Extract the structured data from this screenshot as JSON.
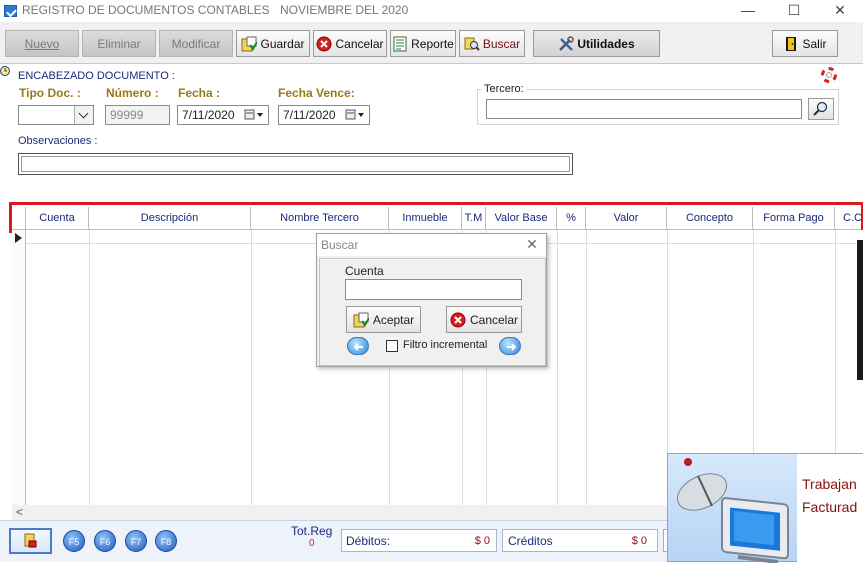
{
  "window": {
    "title": "REGISTRO DE DOCUMENTOS CONTABLES",
    "period": "NOVIEMBRE DEL 2020",
    "minimize": "—",
    "maximize": "☐",
    "close": "✕"
  },
  "toolbar": {
    "nuevo": "Nuevo",
    "eliminar": "Eliminar",
    "modificar": "Modificar",
    "guardar": "Guardar",
    "cancelar": "Cancelar",
    "reporte": "Reporte",
    "buscar": "Buscar",
    "utilidades": "Utilidades",
    "salir": "Salir"
  },
  "header": {
    "section_title": "ENCABEZADO DOCUMENTO :",
    "tipo_doc_label": "Tipo Doc. :",
    "tipo_doc_value": "",
    "numero_label": "Número :",
    "numero_value": "99999",
    "fecha_label": "Fecha :",
    "fecha_value": "7/11/2020",
    "fecha_vence_label": "Fecha Vence:",
    "fecha_vence_value": "7/11/2020",
    "tercero_label": "Tercero:",
    "tercero_value": "",
    "observaciones_label": "Observaciones :",
    "observaciones_value": ""
  },
  "grid": {
    "columns": [
      "Cuenta",
      "Descripción",
      "Nombre Tercero",
      "Inmueble",
      "T.M",
      "Valor Base",
      "%",
      "Valor",
      "Concepto",
      "Forma Pago",
      "C.C"
    ]
  },
  "dialog": {
    "title": "Buscar",
    "field_label": "Cuenta",
    "field_value": "",
    "accept": "Aceptar",
    "cancel": "Cancelar",
    "filter_label": "Filtro incremental",
    "filter_checked": false
  },
  "status": {
    "fkeys": [
      "F5",
      "F6",
      "F7",
      "F8"
    ],
    "totreg_label": "Tot.Reg",
    "totreg_value": "0",
    "debitos_label": "Débitos:",
    "debitos_value": "$ 0",
    "creditos_label": "Créditos",
    "creditos_value": "$ 0"
  },
  "popup": {
    "line1": "Trabajan",
    "line2": "Facturad"
  },
  "colors": {
    "highlight": "#d8191f",
    "gold_label": "#9a7a16",
    "blue_label": "#1a2a7a"
  }
}
